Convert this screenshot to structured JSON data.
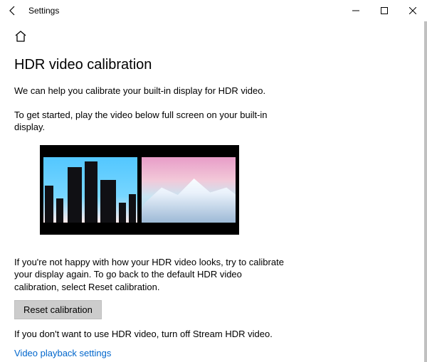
{
  "window": {
    "title": "Settings"
  },
  "page": {
    "heading": "HDR video calibration",
    "intro": "We can help you calibrate your built-in display for HDR video.",
    "instruction": "To get started, play the video below full screen on your built-in display.",
    "note": "If you're not happy with how your HDR video looks, try to calibrate your display again. To go back to the default HDR video calibration, select Reset calibration.",
    "reset_label": "Reset calibration",
    "turn_off_note": "If you don't want to use HDR video, turn off Stream HDR video.",
    "link_label": "Video playback settings"
  }
}
